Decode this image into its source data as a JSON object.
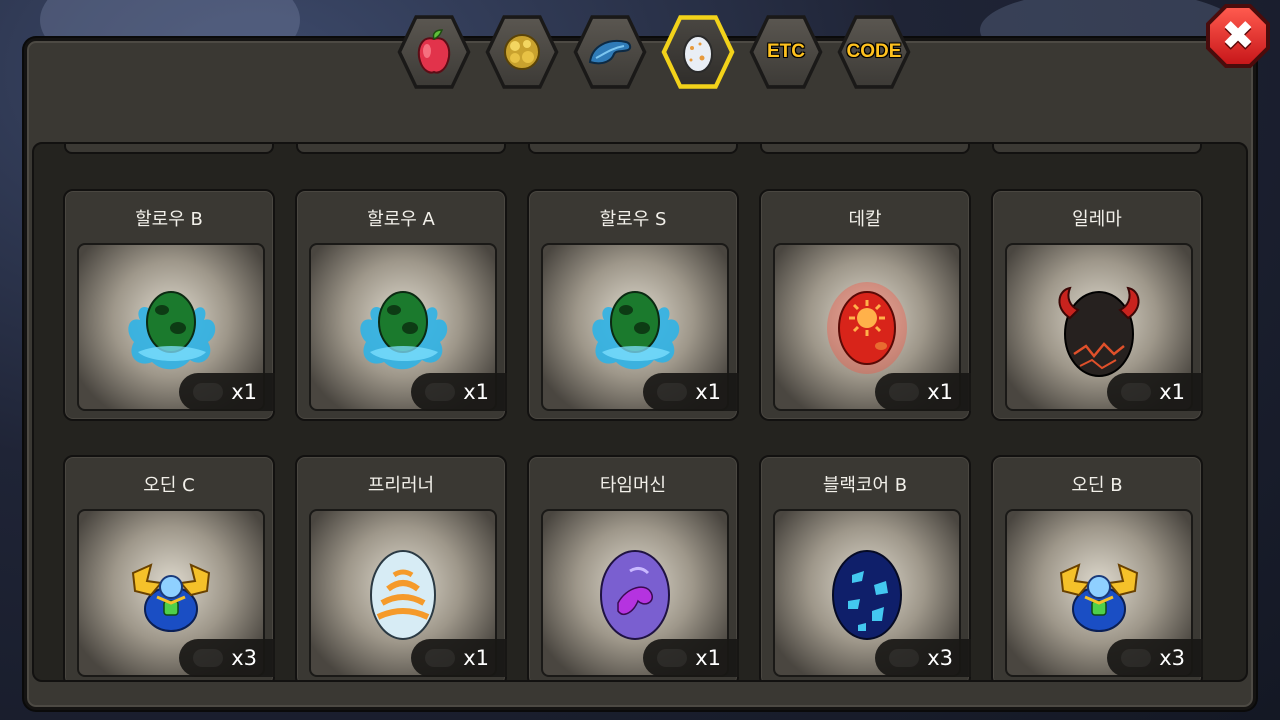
{
  "tabs": [
    {
      "name": "fruit",
      "icon": "red-fruit-icon",
      "label": ""
    },
    {
      "name": "gold",
      "icon": "gold-ore-icon",
      "label": ""
    },
    {
      "name": "creature",
      "icon": "blue-creature-icon",
      "label": ""
    },
    {
      "name": "egg",
      "icon": "egg-icon",
      "label": "",
      "active": true
    },
    {
      "name": "etc",
      "icon": "",
      "label": "ETC"
    },
    {
      "name": "code",
      "icon": "",
      "label": "CODE"
    }
  ],
  "close_label": "✖",
  "items": [
    {
      "name": "할로우 B",
      "count": "x1",
      "egg": "hollow-egg-icon"
    },
    {
      "name": "할로우 A",
      "count": "x1",
      "egg": "hollow-egg-icon"
    },
    {
      "name": "할로우 S",
      "count": "x1",
      "egg": "hollow-egg-icon"
    },
    {
      "name": "데칼",
      "count": "x1",
      "egg": "red-sun-egg-icon"
    },
    {
      "name": "일레마",
      "count": "x1",
      "egg": "horned-black-egg-icon"
    },
    {
      "name": "오딘 C",
      "count": "x3",
      "egg": "golden-wing-egg-icon"
    },
    {
      "name": "프리러너",
      "count": "x1",
      "egg": "striped-egg-icon"
    },
    {
      "name": "타임머신",
      "count": "x1",
      "egg": "purple-egg-icon"
    },
    {
      "name": "블랙코어 B",
      "count": "x3",
      "egg": "blue-spotted-egg-icon"
    },
    {
      "name": "오딘 B",
      "count": "x3",
      "egg": "golden-wing-egg-icon"
    }
  ],
  "colors": {
    "panel": "#3a3833",
    "active_tab_border": "#f2d21a",
    "tab_text": "#ffc21f",
    "close_button": "#e0231f"
  }
}
